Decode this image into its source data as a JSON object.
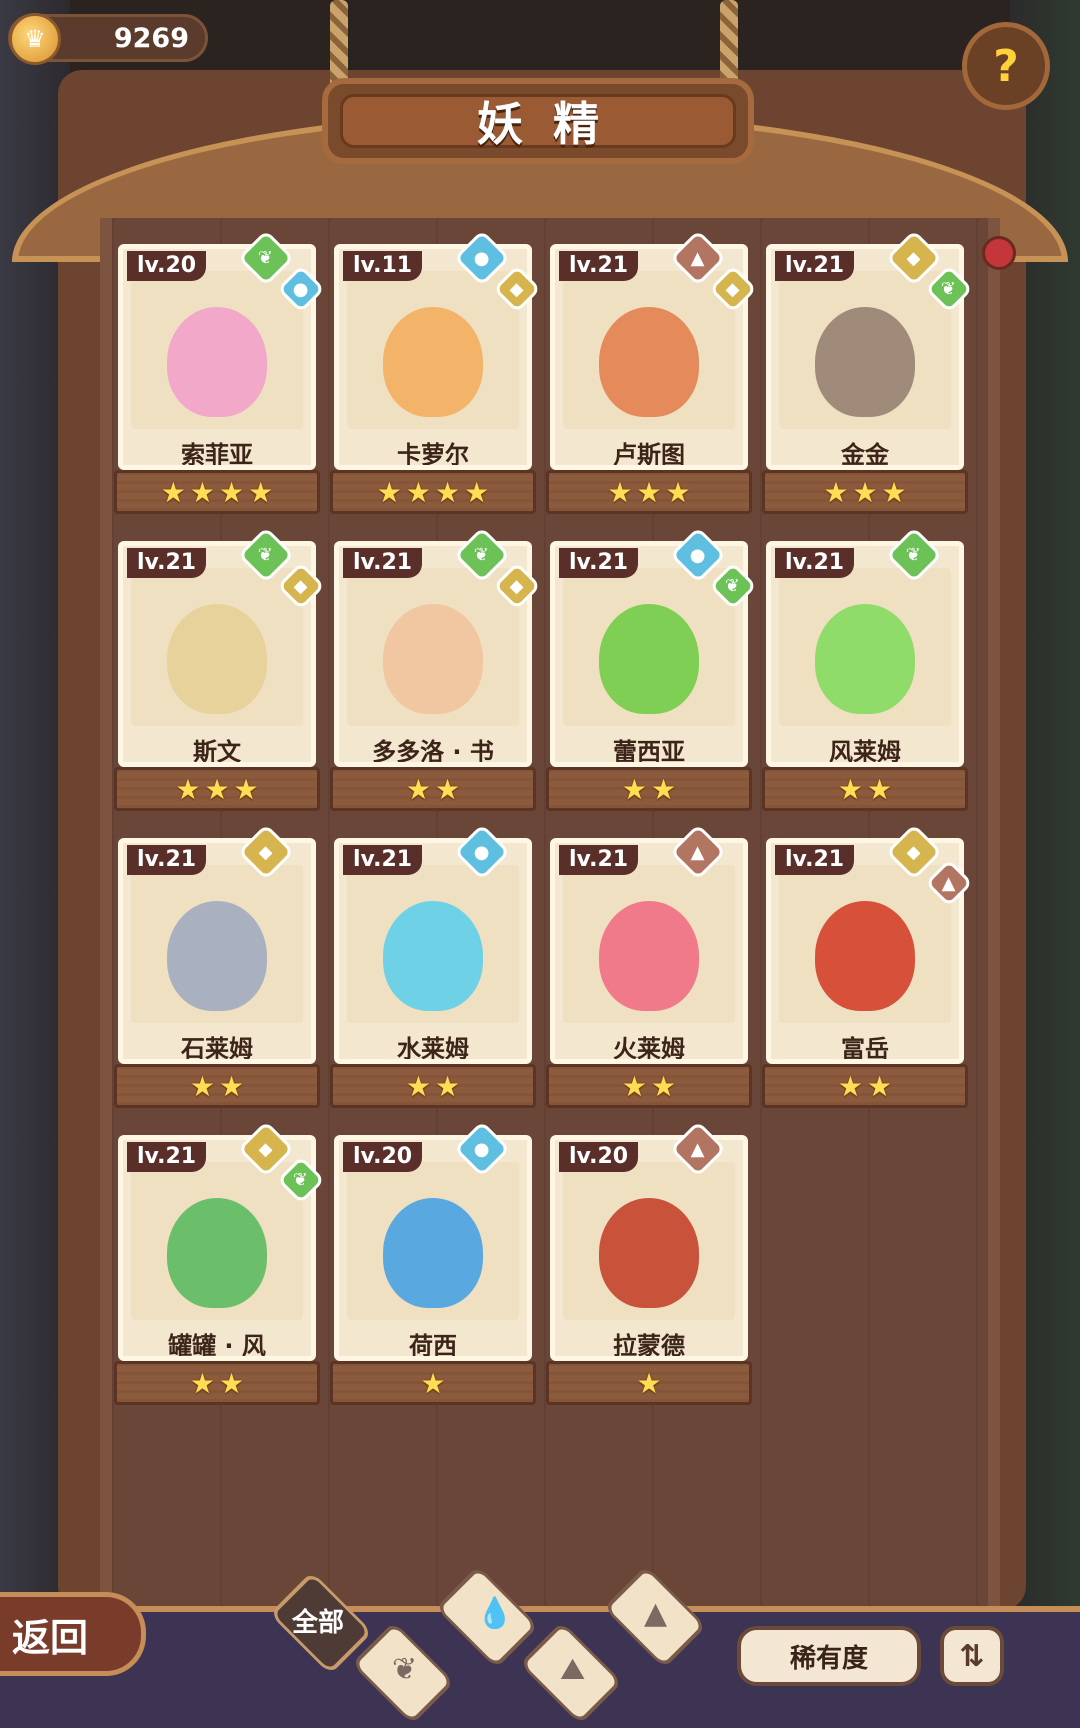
{
  "currency": {
    "icon": "crown-coin-icon",
    "value": "9269"
  },
  "help": {
    "icon": "question-sprout-icon",
    "glyph": "?"
  },
  "title": "妖精",
  "cards": [
    {
      "level": "lv.20",
      "name": "索菲亚",
      "stars": 4,
      "elements": [
        "grass",
        "water"
      ]
    },
    {
      "level": "lv.11",
      "name": "卡萝尔",
      "stars": 4,
      "elements": [
        "water",
        "earth"
      ]
    },
    {
      "level": "lv.21",
      "name": "卢斯图",
      "stars": 3,
      "elements": [
        "fire",
        "earth"
      ]
    },
    {
      "level": "lv.21",
      "name": "金金",
      "stars": 3,
      "elements": [
        "earth",
        "grass"
      ]
    },
    {
      "level": "lv.21",
      "name": "斯文",
      "stars": 3,
      "elements": [
        "grass",
        "earth"
      ]
    },
    {
      "level": "lv.21",
      "name": "多多洛 · 书",
      "stars": 2,
      "elements": [
        "grass",
        "earth"
      ]
    },
    {
      "level": "lv.21",
      "name": "蕾西亚",
      "stars": 2,
      "elements": [
        "water",
        "grass"
      ]
    },
    {
      "level": "lv.21",
      "name": "风莱姆",
      "stars": 2,
      "elements": [
        "grass"
      ]
    },
    {
      "level": "lv.21",
      "name": "石莱姆",
      "stars": 2,
      "elements": [
        "earth"
      ]
    },
    {
      "level": "lv.21",
      "name": "水莱姆",
      "stars": 2,
      "elements": [
        "water"
      ]
    },
    {
      "level": "lv.21",
      "name": "火莱姆",
      "stars": 2,
      "elements": [
        "fire"
      ]
    },
    {
      "level": "lv.21",
      "name": "富岳",
      "stars": 2,
      "elements": [
        "earth",
        "fire"
      ]
    },
    {
      "level": "lv.21",
      "name": "罐罐 · 风",
      "stars": 2,
      "elements": [
        "earth",
        "grass"
      ]
    },
    {
      "level": "lv.20",
      "name": "荷西",
      "stars": 1,
      "elements": [
        "water"
      ]
    },
    {
      "level": "lv.20",
      "name": "拉蒙德",
      "stars": 1,
      "elements": [
        "fire"
      ]
    }
  ],
  "bottom": {
    "back_label": "返回",
    "filters": [
      {
        "label": "全部",
        "icon": ""
      },
      {
        "label": "",
        "icon": "grass-filter-icon"
      },
      {
        "label": "",
        "icon": "water-filter-icon"
      },
      {
        "label": "",
        "icon": "earth-filter-icon"
      },
      {
        "label": "",
        "icon": "fire-filter-icon"
      }
    ],
    "rarity_label": "稀有度",
    "sort_icon": "sort-order-icon"
  },
  "colors": {
    "grass": "#6cc257",
    "water": "#5fbfe0",
    "earth": "#d6b54e",
    "fire": "#b27561",
    "panel": "#6a4638",
    "star": "#ffdd55"
  }
}
